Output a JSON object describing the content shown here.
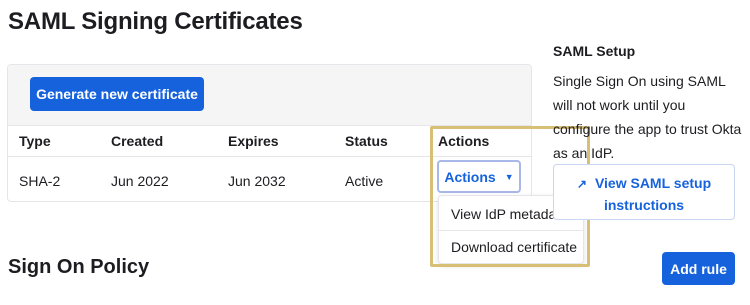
{
  "page": {
    "title": "SAML Signing Certificates"
  },
  "certificates": {
    "generate_label": "Generate new certificate",
    "columns": [
      "Type",
      "Created",
      "Expires",
      "Status",
      "Actions"
    ],
    "rows": [
      {
        "type": "SHA-2",
        "created": "Jun 2022",
        "expires": "Jun 2032",
        "status": "Active",
        "actions_label": "Actions"
      }
    ],
    "menu": [
      "View IdP metadata",
      "Download certificate"
    ]
  },
  "saml_setup": {
    "title": "SAML Setup",
    "description": "Single Sign On using SAML will not work until you configure the app to trust Okta as an IdP.",
    "button_label": "View SAML setup instructions",
    "button_icon": "external-link-icon"
  },
  "sign_on_policy": {
    "title": "Sign On Policy",
    "add_rule_label": "Add rule"
  },
  "colors": {
    "accent": "#1662dd",
    "highlight": "#d8bf76",
    "border": "#e6e6ea"
  }
}
